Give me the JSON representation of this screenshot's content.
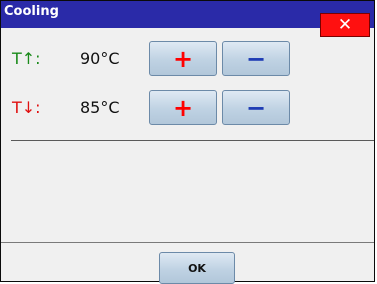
{
  "window": {
    "title": "Cooling",
    "close_label": "✕"
  },
  "rows": [
    {
      "label": "T↑:",
      "label_color": "#1a8a1a",
      "value": "90°C",
      "plus": "+",
      "minus": "−"
    },
    {
      "label": "T↓:",
      "label_color": "#e01010",
      "value": "85°C",
      "plus": "+",
      "minus": "−"
    }
  ],
  "colors": {
    "titlebar": "#2a2aa8",
    "plus": "#ff0000",
    "minus": "#1e3cb4"
  },
  "footer": {
    "ok_label": "OK"
  }
}
